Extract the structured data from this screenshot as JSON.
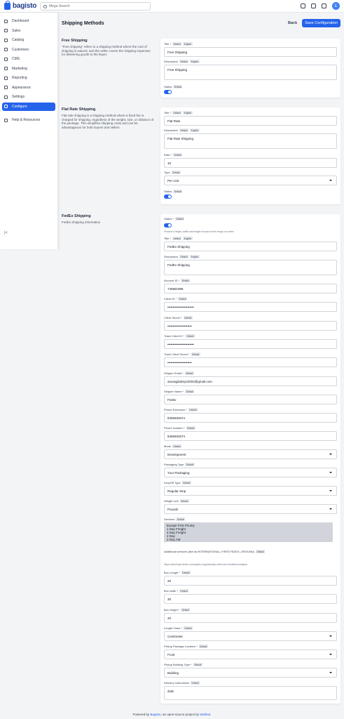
{
  "app": {
    "logo_text": "bagisto",
    "search_placeholder": "Mega Search",
    "avatar_initial": "E"
  },
  "sidebar": {
    "items": [
      {
        "label": "Dashboard",
        "icon": "dashboard-icon"
      },
      {
        "label": "Sales",
        "icon": "sales-icon"
      },
      {
        "label": "Catalog",
        "icon": "catalog-icon"
      },
      {
        "label": "Customers",
        "icon": "customers-icon"
      },
      {
        "label": "CMS",
        "icon": "cms-icon"
      },
      {
        "label": "Marketing",
        "icon": "marketing-icon"
      },
      {
        "label": "Reporting",
        "icon": "reporting-icon"
      },
      {
        "label": "Appearance",
        "icon": "appearance-icon"
      },
      {
        "label": "Settings",
        "icon": "settings-icon"
      },
      {
        "label": "Configure",
        "icon": "configure-icon"
      },
      {
        "label": "Help & Resources",
        "icon": "help-icon"
      }
    ],
    "collapse_icon": "collapse-icon"
  },
  "header": {
    "title": "Shipping Methods",
    "back": "Back",
    "save": "Save Configuration"
  },
  "badges": {
    "default": "Default",
    "english": "English"
  },
  "free": {
    "title": "Free Shipping",
    "desc": "\"Free shipping\" refers to a shipping method where the cost of shipping is waived, and the seller covers the shipping expenses for delivering goods to the buyer.",
    "title_label": "Title *",
    "title_value": "Free Shipping",
    "desc_label": "Description",
    "desc_value": "Free Shipping",
    "status_label": "Status"
  },
  "flat": {
    "title": "Flat Rate Shipping",
    "desc": "Flat-rate shipping is a shipping method where a fixed fee is charged for shipping, regardless of the weight, size, or distance of the package. This simplifies shipping costs and can be advantageous for both buyers and sellers.",
    "title_label": "Title *",
    "title_value": "Flat Rate",
    "desc_label": "Description",
    "desc_value": "Flat Rate Shipping",
    "rate_label": "Rate *",
    "rate_value": "10",
    "type_label": "Type",
    "type_value": "Per Unit",
    "status_label": "Status"
  },
  "fedex": {
    "title": "FedEx Shipping",
    "desc": "FedEx Shipping information",
    "status_label": "Status *",
    "note": "Product's height, width and length should not be empty on active",
    "title_label": "Title *",
    "title_value": "FedEx Shipping",
    "desc_label": "Description",
    "desc_value": "FedEx Shipping",
    "account_label": "Account ID *",
    "account_value": "749581998",
    "client_label": "Client ID *",
    "client_value": "••••••••••••••••••••••••",
    "secret_label": "Client Secret *",
    "secret_value": "••••••••••••••••••••••",
    "track_id_label": "Track Client ID *",
    "track_id_value": "••••••••••••••••••••••••",
    "track_secret_label": "Track Client Secret *",
    "track_secret_value": "••••••••••••••••••••••",
    "email_label": "Shipper Email *",
    "email_value": "anuragdubey22004@gmail.com",
    "name_label": "Shipper Name *",
    "name_value": "Fedex",
    "ext_label": "Phone Extension *",
    "ext_value": "8456932574",
    "phone_label": "Phone Number *",
    "phone_value": "8456932574",
    "mode_label": "Mode",
    "mode_value": "Development",
    "pack_label": "Packaging Type",
    "pack_value": "Your Packaging",
    "dropoff_label": "DropOff Type",
    "dropoff_value": "Regular Stop",
    "weight_label": "Weight Unit",
    "weight_value": "Pounds",
    "services_label": "Services",
    "services_options": [
      "Europe First Priority",
      "1 Day Freight",
      "2 Day Freight",
      "2 Day",
      "2 Day AM"
    ],
    "additional_label": "Additional services (like as INTERNATIONAL_FIRST,FEDEX_GROUND)",
    "additional_note": "https://developer.fedex.com/api/en-in/guides/api-reference.html#servicetypes",
    "box_length_label": "Box Length *",
    "box_length_value": "20",
    "box_width_label": "Box width *",
    "box_width_value": "30",
    "box_height_label": "Box Height *",
    "box_height_value": "20",
    "length_class_label": "Length Class *",
    "length_class_value": "Centimeter",
    "pickup_loc_label": "Pickup Package Location *",
    "pickup_loc_value": "Front",
    "pickup_building_label": "Pickup Building Type *",
    "pickup_building_value": "Building",
    "delivery_label": "Delivery Instructions",
    "delivery_value": "dsdc"
  },
  "footer": {
    "prefix": "Powered by ",
    "link1": "Bagisto",
    "middle": ", an open-source project by ",
    "link2": "Webkul",
    "suffix": "."
  }
}
